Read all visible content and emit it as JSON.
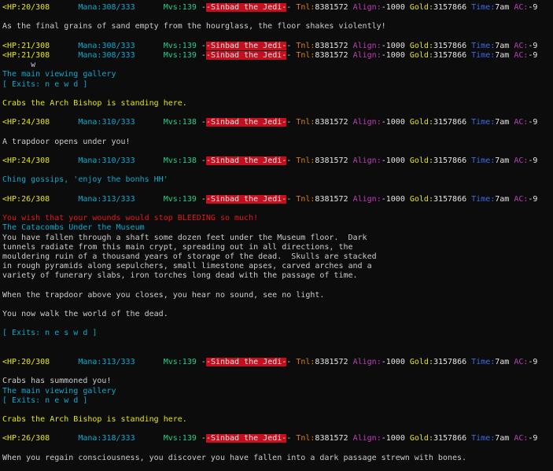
{
  "lines": [
    [
      {
        "t": "<HP:20/308",
        "c": "yellow"
      },
      {
        "t": "      Mana:308/333",
        "c": "cyan"
      },
      {
        "t": "      Mvs:139",
        "c": "green"
      },
      {
        "t": " -",
        "c": "gray"
      },
      {
        "t": "-Sinbad the Jedi-",
        "c": "hl"
      },
      {
        "t": "- ",
        "c": "gray"
      },
      {
        "t": "Tnl:",
        "c": "orange"
      },
      {
        "t": "8381572",
        "c": "white"
      },
      {
        "t": " Align:",
        "c": "magenta"
      },
      {
        "t": "-1000",
        "c": "white"
      },
      {
        "t": " Gold:",
        "c": "yellow"
      },
      {
        "t": "3157866",
        "c": "white"
      },
      {
        "t": " Time:",
        "c": "blue"
      },
      {
        "t": "7am",
        "c": "white"
      },
      {
        "t": " AC:",
        "c": "magenta"
      },
      {
        "t": "-9",
        "c": "white"
      }
    ],
    [],
    [
      {
        "t": "As the final grains of sand empty from the hourglass, the floor shakes violently!",
        "c": "gray"
      }
    ],
    [],
    [
      {
        "t": "<HP:21/308",
        "c": "yellow"
      },
      {
        "t": "      Mana:308/333",
        "c": "cyan"
      },
      {
        "t": "      Mvs:139",
        "c": "green"
      },
      {
        "t": " -",
        "c": "gray"
      },
      {
        "t": "-Sinbad the Jedi-",
        "c": "hl"
      },
      {
        "t": "- ",
        "c": "gray"
      },
      {
        "t": "Tnl:",
        "c": "orange"
      },
      {
        "t": "8381572",
        "c": "white"
      },
      {
        "t": " Align:",
        "c": "magenta"
      },
      {
        "t": "-1000",
        "c": "white"
      },
      {
        "t": " Gold:",
        "c": "yellow"
      },
      {
        "t": "3157866",
        "c": "white"
      },
      {
        "t": " Time:",
        "c": "blue"
      },
      {
        "t": "7am",
        "c": "white"
      },
      {
        "t": " AC:",
        "c": "magenta"
      },
      {
        "t": "-9",
        "c": "white"
      }
    ],
    [
      {
        "t": "<HP:21/308",
        "c": "yellow"
      },
      {
        "t": "      Mana:308/333",
        "c": "cyan"
      },
      {
        "t": "      Mvs:139",
        "c": "green"
      },
      {
        "t": " -",
        "c": "gray"
      },
      {
        "t": "-Sinbad the Jedi-",
        "c": "hl"
      },
      {
        "t": "- ",
        "c": "gray"
      },
      {
        "t": "Tnl:",
        "c": "orange"
      },
      {
        "t": "8381572",
        "c": "white"
      },
      {
        "t": " Align:",
        "c": "magenta"
      },
      {
        "t": "-1000",
        "c": "white"
      },
      {
        "t": " Gold:",
        "c": "yellow"
      },
      {
        "t": "3157866",
        "c": "white"
      },
      {
        "t": " Time:",
        "c": "blue"
      },
      {
        "t": "7am",
        "c": "white"
      },
      {
        "t": " AC:",
        "c": "magenta"
      },
      {
        "t": "-9",
        "c": "white"
      }
    ],
    [
      {
        "t": "      w",
        "c": "gray"
      }
    ],
    [
      {
        "t": "The main viewing gallery",
        "c": "cyan"
      }
    ],
    [
      {
        "t": "[ Exits: n e w d ]",
        "c": "cyan"
      }
    ],
    [],
    [
      {
        "t": "Crabs the Arch Bishop is standing here.",
        "c": "yellow"
      }
    ],
    [],
    [
      {
        "t": "<HP:24/308",
        "c": "yellow"
      },
      {
        "t": "      Mana:310/333",
        "c": "cyan"
      },
      {
        "t": "      Mvs:138",
        "c": "green"
      },
      {
        "t": " -",
        "c": "gray"
      },
      {
        "t": "-Sinbad the Jedi-",
        "c": "hl"
      },
      {
        "t": "- ",
        "c": "gray"
      },
      {
        "t": "Tnl:",
        "c": "orange"
      },
      {
        "t": "8381572",
        "c": "white"
      },
      {
        "t": " Align:",
        "c": "magenta"
      },
      {
        "t": "-1000",
        "c": "white"
      },
      {
        "t": " Gold:",
        "c": "yellow"
      },
      {
        "t": "3157866",
        "c": "white"
      },
      {
        "t": " Time:",
        "c": "blue"
      },
      {
        "t": "7am",
        "c": "white"
      },
      {
        "t": " AC:",
        "c": "magenta"
      },
      {
        "t": "-9",
        "c": "white"
      }
    ],
    [],
    [
      {
        "t": "A trapdoor opens under you!",
        "c": "gray"
      }
    ],
    [],
    [
      {
        "t": "<HP:24/308",
        "c": "yellow"
      },
      {
        "t": "      Mana:310/333",
        "c": "cyan"
      },
      {
        "t": "      Mvs:138",
        "c": "green"
      },
      {
        "t": " -",
        "c": "gray"
      },
      {
        "t": "-Sinbad the Jedi-",
        "c": "hl"
      },
      {
        "t": "- ",
        "c": "gray"
      },
      {
        "t": "Tnl:",
        "c": "orange"
      },
      {
        "t": "8381572",
        "c": "white"
      },
      {
        "t": " Align:",
        "c": "magenta"
      },
      {
        "t": "-1000",
        "c": "white"
      },
      {
        "t": " Gold:",
        "c": "yellow"
      },
      {
        "t": "3157866",
        "c": "white"
      },
      {
        "t": " Time:",
        "c": "blue"
      },
      {
        "t": "7am",
        "c": "white"
      },
      {
        "t": " AC:",
        "c": "magenta"
      },
      {
        "t": "-9",
        "c": "white"
      }
    ],
    [],
    [
      {
        "t": "Ching gossips, 'enjoy the bonhs HH'",
        "c": "cyan"
      }
    ],
    [],
    [
      {
        "t": "<HP:26/308",
        "c": "yellow"
      },
      {
        "t": "      Mana:313/333",
        "c": "cyan"
      },
      {
        "t": "      Mvs:139",
        "c": "green"
      },
      {
        "t": " -",
        "c": "gray"
      },
      {
        "t": "-Sinbad the Jedi-",
        "c": "hl"
      },
      {
        "t": "- ",
        "c": "gray"
      },
      {
        "t": "Tnl:",
        "c": "orange"
      },
      {
        "t": "8381572",
        "c": "white"
      },
      {
        "t": " Align:",
        "c": "magenta"
      },
      {
        "t": "-1000",
        "c": "white"
      },
      {
        "t": " Gold:",
        "c": "yellow"
      },
      {
        "t": "3157866",
        "c": "white"
      },
      {
        "t": " Time:",
        "c": "blue"
      },
      {
        "t": "7am",
        "c": "white"
      },
      {
        "t": " AC:",
        "c": "magenta"
      },
      {
        "t": "-9",
        "c": "white"
      }
    ],
    [],
    [
      {
        "t": "You wish that your wounds would stop BLEEDING so much!",
        "c": "red"
      }
    ],
    [
      {
        "t": "The Catacombs Under the Museum",
        "c": "cyan"
      }
    ],
    [
      {
        "t": "You have fallen through a shaft some dozen feet under the Museum floor.  Dark",
        "c": "gray"
      }
    ],
    [
      {
        "t": "tunnels radiate from this main crypt, spreading out in all directions, the",
        "c": "gray"
      }
    ],
    [
      {
        "t": "mouldering ruin of a thousand years of storage of the dead.  Skulls are stacked",
        "c": "gray"
      }
    ],
    [
      {
        "t": "in rough pyramids along sepulchers, small limestone apses, carved arches and a",
        "c": "gray"
      }
    ],
    [
      {
        "t": "variety of funerary slabs, iron torches long dead with the passage of time.",
        "c": "gray"
      }
    ],
    [],
    [
      {
        "t": "When the trapdoor above you closes, you hear no sound, see no light.",
        "c": "gray"
      }
    ],
    [],
    [
      {
        "t": "You now walk the world of the dead.",
        "c": "gray"
      }
    ],
    [],
    [
      {
        "t": "[ Exits: n e s w d ]",
        "c": "cyan"
      }
    ],
    [],
    [],
    [
      {
        "t": "<HP:20/308",
        "c": "yellow"
      },
      {
        "t": "      Mana:313/333",
        "c": "cyan"
      },
      {
        "t": "      Mvs:139",
        "c": "green"
      },
      {
        "t": " -",
        "c": "gray"
      },
      {
        "t": "-Sinbad the Jedi-",
        "c": "hl"
      },
      {
        "t": "- ",
        "c": "gray"
      },
      {
        "t": "Tnl:",
        "c": "orange"
      },
      {
        "t": "8381572",
        "c": "white"
      },
      {
        "t": " Align:",
        "c": "magenta"
      },
      {
        "t": "-1000",
        "c": "white"
      },
      {
        "t": " Gold:",
        "c": "yellow"
      },
      {
        "t": "3157866",
        "c": "white"
      },
      {
        "t": " Time:",
        "c": "blue"
      },
      {
        "t": "7am",
        "c": "white"
      },
      {
        "t": " AC:",
        "c": "magenta"
      },
      {
        "t": "-9",
        "c": "white"
      }
    ],
    [],
    [
      {
        "t": "Crabs has summoned you!",
        "c": "gray"
      }
    ],
    [
      {
        "t": "The main viewing gallery",
        "c": "cyan"
      }
    ],
    [
      {
        "t": "[ Exits: n e w d ]",
        "c": "cyan"
      }
    ],
    [],
    [
      {
        "t": "Crabs the Arch Bishop is standing here.",
        "c": "yellow"
      }
    ],
    [],
    [
      {
        "t": "<HP:26/308",
        "c": "yellow"
      },
      {
        "t": "      Mana:318/333",
        "c": "cyan"
      },
      {
        "t": "      Mvs:139",
        "c": "green"
      },
      {
        "t": " -",
        "c": "gray"
      },
      {
        "t": "-Sinbad the Jedi-",
        "c": "hl"
      },
      {
        "t": "- ",
        "c": "gray"
      },
      {
        "t": "Tnl:",
        "c": "orange"
      },
      {
        "t": "8381572",
        "c": "white"
      },
      {
        "t": " Align:",
        "c": "magenta"
      },
      {
        "t": "-1000",
        "c": "white"
      },
      {
        "t": " Gold:",
        "c": "yellow"
      },
      {
        "t": "3157866",
        "c": "white"
      },
      {
        "t": " Time:",
        "c": "blue"
      },
      {
        "t": "7am",
        "c": "white"
      },
      {
        "t": " AC:",
        "c": "magenta"
      },
      {
        "t": "-9",
        "c": "white"
      }
    ],
    [],
    [
      {
        "t": "When you regain consciousness, you discover you have fallen into a dark passage strewn with bones.",
        "c": "gray"
      }
    ]
  ],
  "colors": {
    "background": "#0c0c0c",
    "gray": "#cccccc",
    "yellow": "#e5e510",
    "cyan": "#11a8cd",
    "green": "#23d18b",
    "red": "#e01b1b",
    "orange": "#d7801a",
    "magenta": "#bc3fbc",
    "blue": "#3b6ee5",
    "white": "#e5e5e5",
    "highlight_bg": "#c50f1f"
  }
}
